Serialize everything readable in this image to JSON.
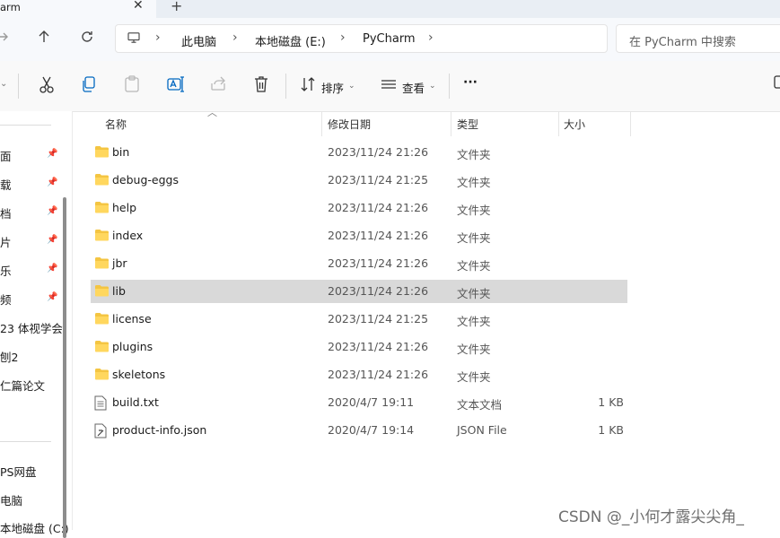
{
  "window": {
    "tab_title": "arm",
    "tab_close": "✕",
    "tab_new": "+"
  },
  "nav": {
    "breadcrumbs": [
      "此电脑",
      "本地磁盘 (E:)",
      "PyCharm"
    ],
    "search_placeholder": "在 PyCharm 中搜索"
  },
  "toolbar": {
    "sort_label": "排序",
    "view_label": "查看",
    "more_label": "···",
    "icons": [
      "cut-icon",
      "copy-icon",
      "paste-icon",
      "rename-icon",
      "share-icon",
      "delete-icon"
    ]
  },
  "sidebar": {
    "pinned": [
      "面",
      "载",
      "档",
      "片",
      "乐",
      "频"
    ],
    "items": [
      "23 体视学会",
      "刨2",
      "仁篇论文"
    ],
    "drives": [
      "PS网盘",
      "电脑",
      "本地磁盘 (C:)"
    ]
  },
  "columns": {
    "name": "名称",
    "modified": "修改日期",
    "type": "类型",
    "size": "大小"
  },
  "files": [
    {
      "name": "bin",
      "modified": "2023/11/24 21:26",
      "type": "文件夹",
      "size": "",
      "icon": "folder-icon",
      "selected": false
    },
    {
      "name": "debug-eggs",
      "modified": "2023/11/24 21:25",
      "type": "文件夹",
      "size": "",
      "icon": "folder-icon",
      "selected": false
    },
    {
      "name": "help",
      "modified": "2023/11/24 21:26",
      "type": "文件夹",
      "size": "",
      "icon": "folder-icon",
      "selected": false
    },
    {
      "name": "index",
      "modified": "2023/11/24 21:26",
      "type": "文件夹",
      "size": "",
      "icon": "folder-icon",
      "selected": false
    },
    {
      "name": "jbr",
      "modified": "2023/11/24 21:26",
      "type": "文件夹",
      "size": "",
      "icon": "folder-icon",
      "selected": false
    },
    {
      "name": "lib",
      "modified": "2023/11/24 21:26",
      "type": "文件夹",
      "size": "",
      "icon": "folder-icon",
      "selected": true
    },
    {
      "name": "license",
      "modified": "2023/11/24 21:25",
      "type": "文件夹",
      "size": "",
      "icon": "folder-icon",
      "selected": false
    },
    {
      "name": "plugins",
      "modified": "2023/11/24 21:26",
      "type": "文件夹",
      "size": "",
      "icon": "folder-icon",
      "selected": false
    },
    {
      "name": "skeletons",
      "modified": "2023/11/24 21:26",
      "type": "文件夹",
      "size": "",
      "icon": "folder-icon",
      "selected": false
    },
    {
      "name": "build.txt",
      "modified": "2020/4/7 19:11",
      "type": "文本文档",
      "size": "1 KB",
      "icon": "text-file-icon",
      "selected": false
    },
    {
      "name": "product-info.json",
      "modified": "2020/4/7 19:14",
      "type": "JSON File",
      "size": "1 KB",
      "icon": "json-file-icon",
      "selected": false
    }
  ],
  "watermark": "CSDN @_小何才露尖尖角_",
  "colors": {
    "folder": "#f4c542",
    "selected_row": "#d9d9d9",
    "accent": "#0067c0"
  }
}
